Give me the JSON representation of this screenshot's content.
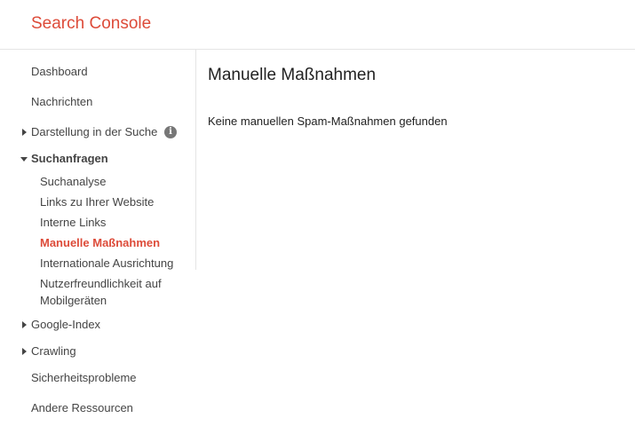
{
  "header": {
    "app_title": "Search Console"
  },
  "sidebar": {
    "dashboard": "Dashboard",
    "messages": "Nachrichten",
    "search_appearance": "Darstellung in der Suche",
    "search_traffic": "Suchanfragen",
    "search_traffic_items": [
      "Suchanalyse",
      "Links zu Ihrer Website",
      "Interne Links",
      "Manuelle Maßnahmen",
      "Internationale Ausrichtung",
      "Nutzerfreundlichkeit auf Mobilgeräten"
    ],
    "active_item": "Manuelle Maßnahmen",
    "google_index": "Google-Index",
    "crawling": "Crawling",
    "security_issues": "Sicherheitsprobleme",
    "other_resources": "Andere Ressourcen"
  },
  "main": {
    "title": "Manuelle Maßnahmen",
    "message": "Keine manuellen Spam-Maßnahmen gefunden"
  },
  "colors": {
    "brand": "#dd4b39",
    "text": "#444444",
    "divider": "#e5e5e5"
  },
  "icons": {
    "collapsed": "triangle-right-icon",
    "expanded": "triangle-down-icon",
    "info": "info-icon"
  }
}
